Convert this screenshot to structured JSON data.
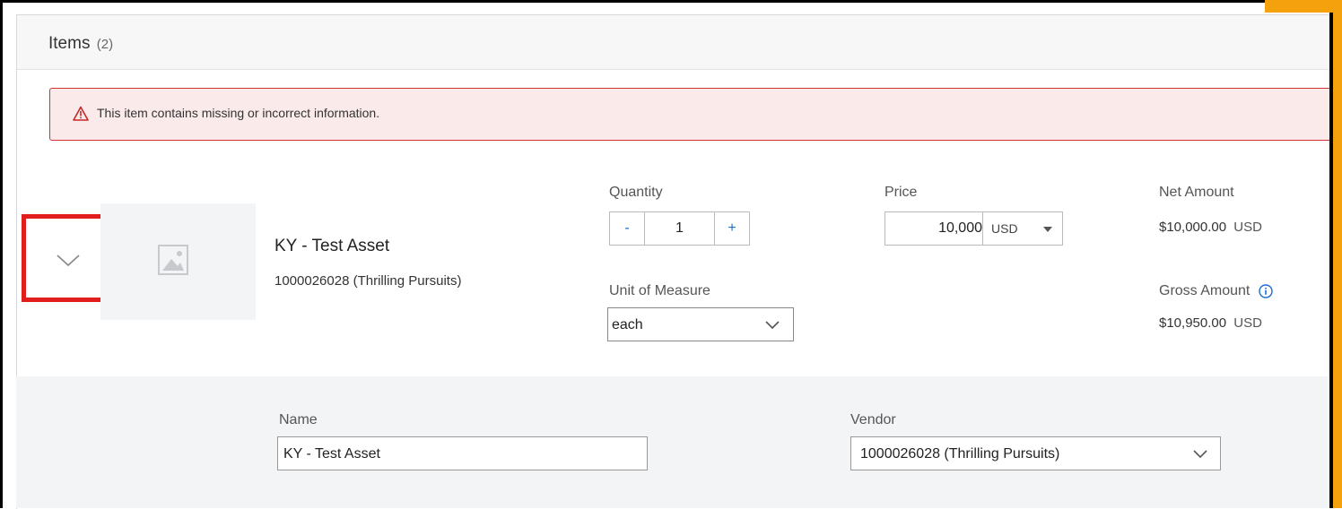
{
  "items_header": {
    "title": "Items",
    "count": "(2)"
  },
  "error": {
    "message": "This item contains missing or incorrect information."
  },
  "item": {
    "name": "KY - Test Asset",
    "subtitle": "1000026028 (Thrilling Pursuits)",
    "quantity_label": "Quantity",
    "quantity_minus": "-",
    "quantity_value": "1",
    "quantity_plus": "+",
    "price_label": "Price",
    "price_value": "10,000",
    "price_currency": "USD",
    "uom_label": "Unit of Measure",
    "uom_value": "each",
    "net_label": "Net Amount",
    "net_value": "$10,000.00",
    "net_currency": "USD",
    "gross_label": "Gross Amount",
    "gross_value": "$10,950.00",
    "gross_currency": "USD"
  },
  "details": {
    "name_label": "Name",
    "name_value": "KY - Test Asset",
    "vendor_label": "Vendor",
    "vendor_value": "1000026028 (Thrilling Pursuits)"
  },
  "icons": {
    "warning": "warning-icon",
    "chevron": "chevron-down-icon",
    "image": "image-placeholder-icon",
    "info": "info-icon"
  },
  "colors": {
    "error_border": "#d23232",
    "error_bg": "#fbeaea",
    "link_blue": "#1a6fd1",
    "highlight_red": "#e01e1e",
    "orange_accent": "#f5a10e"
  }
}
